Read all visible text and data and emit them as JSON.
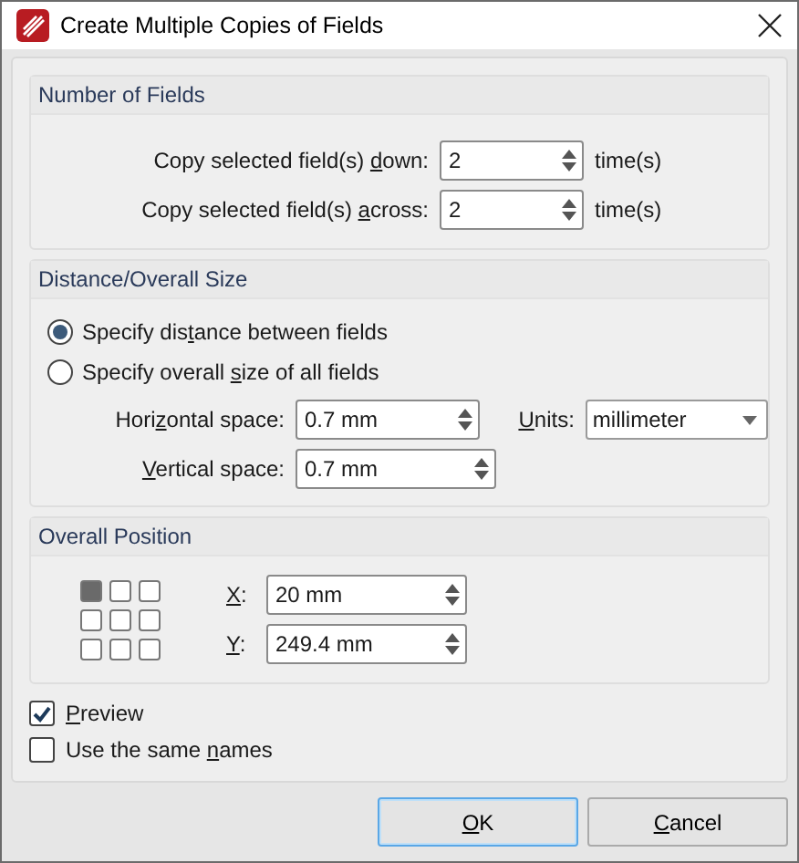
{
  "window": {
    "title": "Create Multiple Copies of Fields"
  },
  "number_of_fields": {
    "title": "Number of Fields",
    "rows": [
      {
        "label": {
          "before": "Copy selected field(s) ",
          "key": "d",
          "after": "own:"
        },
        "value": "2",
        "suffix": "time(s)"
      },
      {
        "label": {
          "before": "Copy selected field(s) ",
          "key": "a",
          "after": "cross:"
        },
        "value": "2",
        "suffix": "time(s)"
      }
    ]
  },
  "distance": {
    "title": "Distance/Overall Size",
    "options": [
      {
        "label": {
          "before": "Specify dis",
          "key": "t",
          "after": "ance between fields"
        },
        "selected": true
      },
      {
        "label": {
          "before": "Specify overall ",
          "key": "s",
          "after": "ize of all fields"
        },
        "selected": false
      }
    ],
    "horizontal": {
      "label": {
        "before": "Hori",
        "key": "z",
        "after": "ontal space:"
      },
      "value": "0.7 mm"
    },
    "vertical": {
      "label": {
        "key": "V",
        "after": "ertical space:"
      },
      "value": "0.7 mm"
    },
    "units": {
      "label": {
        "key": "U",
        "after": "nits:"
      },
      "value": "millimeter"
    }
  },
  "overall_position": {
    "title": "Overall Position",
    "grid": [
      {
        "selected": true
      },
      {
        "selected": false
      },
      {
        "selected": false
      },
      {
        "selected": false
      },
      {
        "selected": false
      },
      {
        "selected": false
      },
      {
        "selected": false
      },
      {
        "selected": false
      },
      {
        "selected": false
      }
    ],
    "x": {
      "label": {
        "key": "X",
        "after": ":"
      },
      "value": "20 mm"
    },
    "y": {
      "label": {
        "key": "Y",
        "after": ":"
      },
      "value": "249.4 mm"
    }
  },
  "checkboxes": [
    {
      "label": {
        "key": "P",
        "after": "review"
      },
      "checked": true
    },
    {
      "label": {
        "before": "Use the same ",
        "key": "n",
        "after": "ames"
      },
      "checked": false
    }
  ],
  "buttons": [
    {
      "label": {
        "key": "O",
        "after": "K"
      },
      "default": true
    },
    {
      "label": {
        "key": "C",
        "after": "ancel"
      },
      "default": false
    }
  ]
}
